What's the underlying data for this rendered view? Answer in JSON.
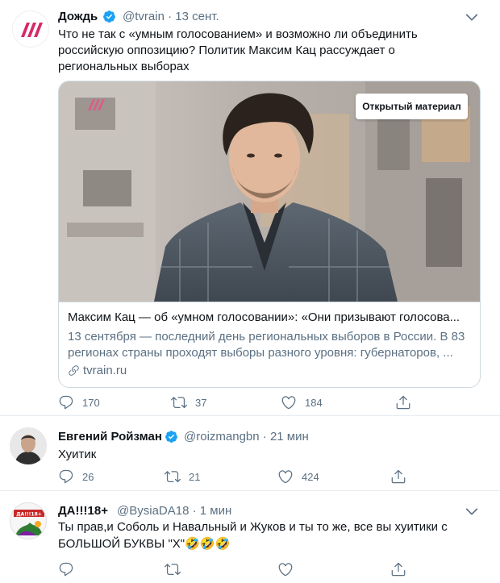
{
  "tweets": [
    {
      "name": "Дождь",
      "handle": "@tvrain",
      "time": "· 13 сент.",
      "text": "Что не так с «умным голосованием» и возможно ли объединить российскую оппозицию? Политик Максим Кац рассуждает о региональных выборах",
      "avatar_icon": "tvrain-logo-icon",
      "card": {
        "badge": "Открытый материал",
        "title": "Максим Кац — об «умном голосовании»: «Они призывают голосова...",
        "description": "13 сентября — последний день региональных выборов в России. В 83 регионах страны проходят выборы разного уровня: губернаторов, ...",
        "link": "tvrain.ru"
      },
      "actions": {
        "replies": "170",
        "retweets": "37",
        "likes": "184"
      }
    },
    {
      "name": "Евгений Ройзман",
      "handle": "@roizmangbn",
      "time": "· 21 мин",
      "text": "Хуитик",
      "actions": {
        "replies": "26",
        "retweets": "21",
        "likes": "424"
      }
    },
    {
      "name": "ДА!!!18+",
      "handle": "@BysiaDA18",
      "time": "· 1 мин",
      "text_line1": "Ты прав,и Соболь и Навальный и Жуков и ты то же, все вы хуитики с",
      "text_line2": "БОЛЬШОЙ БУКВЫ \"Х\"",
      "text_emoji": "🤣🤣🤣",
      "avatar_label": "ДА!!!18+"
    }
  ],
  "colors": {
    "accent_red": "#d62a68",
    "verified_blue": "#1da1f2",
    "secondary_text": "#5b7083",
    "border": "#cfd9de"
  }
}
